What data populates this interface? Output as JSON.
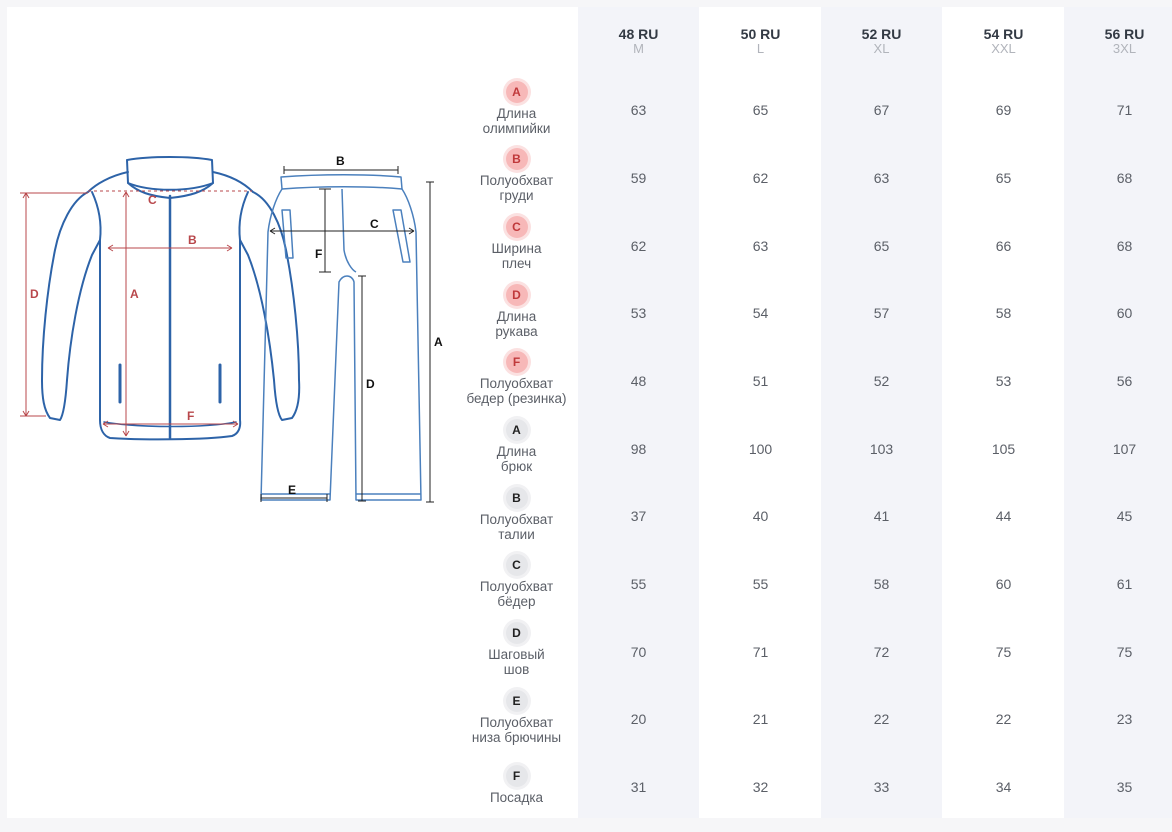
{
  "sizes": [
    {
      "ru": "48 RU",
      "intl": "M"
    },
    {
      "ru": "50 RU",
      "intl": "L"
    },
    {
      "ru": "52 RU",
      "intl": "XL"
    },
    {
      "ru": "54 RU",
      "intl": "XXL"
    },
    {
      "ru": "56 RU",
      "intl": "3XL"
    }
  ],
  "rows": [
    {
      "letter": "A",
      "group": "jacket",
      "label": "Длина\nолимпийки",
      "values": [
        "63",
        "65",
        "67",
        "69",
        "71"
      ]
    },
    {
      "letter": "B",
      "group": "jacket",
      "label": "Полуобхват\nгруди",
      "values": [
        "59",
        "62",
        "63",
        "65",
        "68"
      ]
    },
    {
      "letter": "C",
      "group": "jacket",
      "label": "Ширина\nплеч",
      "values": [
        "62",
        "63",
        "65",
        "66",
        "68"
      ]
    },
    {
      "letter": "D",
      "group": "jacket",
      "label": "Длина\nрукава",
      "values": [
        "53",
        "54",
        "57",
        "58",
        "60"
      ]
    },
    {
      "letter": "F",
      "group": "jacket",
      "label": "Полуобхват\nбедер (резинка)",
      "values": [
        "48",
        "51",
        "52",
        "53",
        "56"
      ]
    },
    {
      "letter": "A",
      "group": "pants",
      "label": "Длина\nбрюк",
      "values": [
        "98",
        "100",
        "103",
        "105",
        "107"
      ]
    },
    {
      "letter": "B",
      "group": "pants",
      "label": "Полуобхват\nталии",
      "values": [
        "37",
        "40",
        "41",
        "44",
        "45"
      ]
    },
    {
      "letter": "C",
      "group": "pants",
      "label": "Полуобхват\nбёдер",
      "values": [
        "55",
        "55",
        "58",
        "60",
        "61"
      ]
    },
    {
      "letter": "D",
      "group": "pants",
      "label": "Шаговый\nшов",
      "values": [
        "70",
        "71",
        "72",
        "75",
        "75"
      ]
    },
    {
      "letter": "E",
      "group": "pants",
      "label": "Полуобхват\nниза брючины",
      "values": [
        "20",
        "21",
        "22",
        "22",
        "23"
      ]
    },
    {
      "letter": "F",
      "group": "pants",
      "label": "Посадка",
      "values": [
        "31",
        "32",
        "33",
        "34",
        "35"
      ]
    }
  ],
  "diagram": {
    "jacket_labels": {
      "a": "A",
      "b": "B",
      "c": "C",
      "d": "D",
      "f": "F"
    },
    "pants_labels": {
      "a": "A",
      "b": "B",
      "c": "C",
      "d": "D",
      "e": "E",
      "f": "F"
    }
  },
  "colors": {
    "jacket_outline": "#2d63a8",
    "jacket_measure": "#b8474b",
    "pants_outline": "#4b80bd",
    "pants_measure": "#222222",
    "badge_red": "#f7b8b8",
    "badge_grey": "#e6e7ea",
    "column_shade": "#f3f4f9"
  }
}
